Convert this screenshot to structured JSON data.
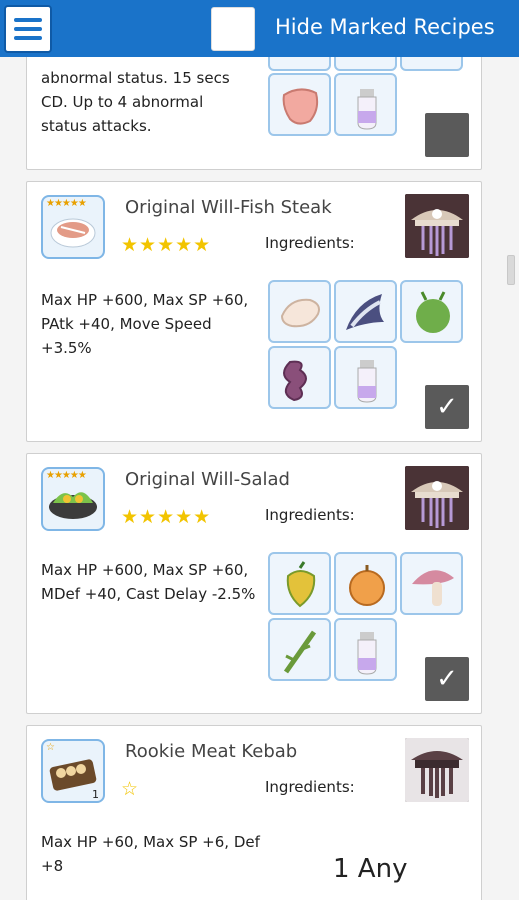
{
  "header": {
    "menu_icon": "hamburger-icon",
    "hide_label": "Hide Marked Recipes",
    "colors": {
      "bar": "#1a73c9"
    }
  },
  "cards": [
    {
      "desc_lines": [
        "abnormal status. 15 secs",
        "CD. Up to 4 abnormal",
        "status attacks."
      ],
      "ingredients": [
        "raw-meat",
        "milk-bottle"
      ],
      "marked": false
    },
    {
      "title": "Original Will-Fish Steak",
      "stars": "★★★★★",
      "ingredients_label": "Ingredients:",
      "desc": "Max HP +600, Max SP +60, PAtk +40, Move Speed +3.5%",
      "ingredients": [
        "fish-fillet",
        "fish",
        "kohlrabi",
        "sausage",
        "milk-bottle"
      ],
      "marked": true,
      "mark_glyph": "✓"
    },
    {
      "title": "Original Will-Salad",
      "stars": "★★★★★",
      "ingredients_label": "Ingredients:",
      "desc": "Max HP +600, Max SP +60, MDef +40, Cast Delay -2.5%",
      "ingredients": [
        "fruit",
        "onion",
        "mushroom",
        "herb-stalk",
        "milk-bottle"
      ],
      "marked": true,
      "mark_glyph": "✓"
    },
    {
      "title": "Rookie Meat Kebab",
      "stars": "☆",
      "ingredients_label": "Ingredients:",
      "desc": "Max HP +60, Max SP +6, Def +8",
      "icon_count": "1",
      "any_text": "1 Any"
    }
  ]
}
